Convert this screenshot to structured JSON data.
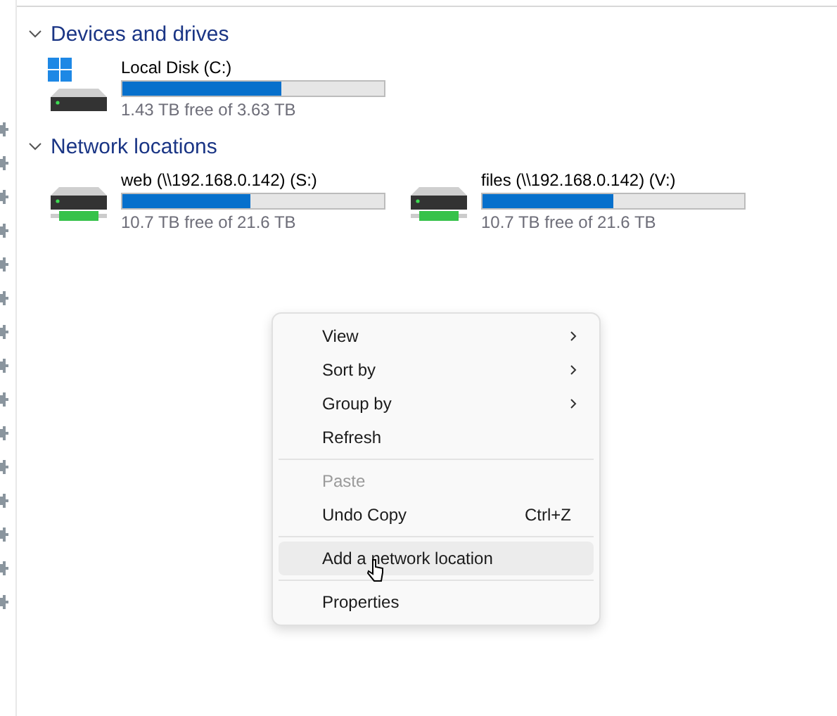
{
  "sections": [
    {
      "title": "Devices and drives",
      "expanded": true,
      "drives": [
        {
          "kind": "local",
          "name": "Local Disk (C:)",
          "level": 0.61,
          "free": "1.43 TB free of 3.63 TB"
        }
      ]
    },
    {
      "title": "Network locations",
      "expanded": true,
      "drives": [
        {
          "kind": "network",
          "name": "web (\\\\192.168.0.142) (S:)",
          "level": 0.49,
          "free": "10.7 TB free of 21.6 TB"
        },
        {
          "kind": "network",
          "name": "files (\\\\192.168.0.142) (V:)",
          "level": 0.5,
          "free": "10.7 TB free of 21.6 TB"
        }
      ]
    }
  ],
  "context_menu": {
    "items": [
      {
        "kind": "item",
        "label": "View",
        "submenu": true,
        "disabled": false,
        "selected": false
      },
      {
        "kind": "item",
        "label": "Sort by",
        "submenu": true,
        "disabled": false,
        "selected": false
      },
      {
        "kind": "item",
        "label": "Group by",
        "submenu": true,
        "disabled": false,
        "selected": false
      },
      {
        "kind": "item",
        "label": "Refresh",
        "submenu": false,
        "disabled": false,
        "selected": false
      },
      {
        "kind": "separator"
      },
      {
        "kind": "item",
        "label": "Paste",
        "submenu": false,
        "disabled": true,
        "selected": false
      },
      {
        "kind": "item",
        "label": "Undo Copy",
        "shortcut": "Ctrl+Z",
        "submenu": false,
        "disabled": false,
        "selected": false
      },
      {
        "kind": "separator"
      },
      {
        "kind": "item",
        "label": "Add a network location",
        "submenu": false,
        "disabled": false,
        "selected": true
      },
      {
        "kind": "separator"
      },
      {
        "kind": "item",
        "label": "Properties",
        "submenu": false,
        "disabled": false,
        "selected": false
      }
    ]
  }
}
